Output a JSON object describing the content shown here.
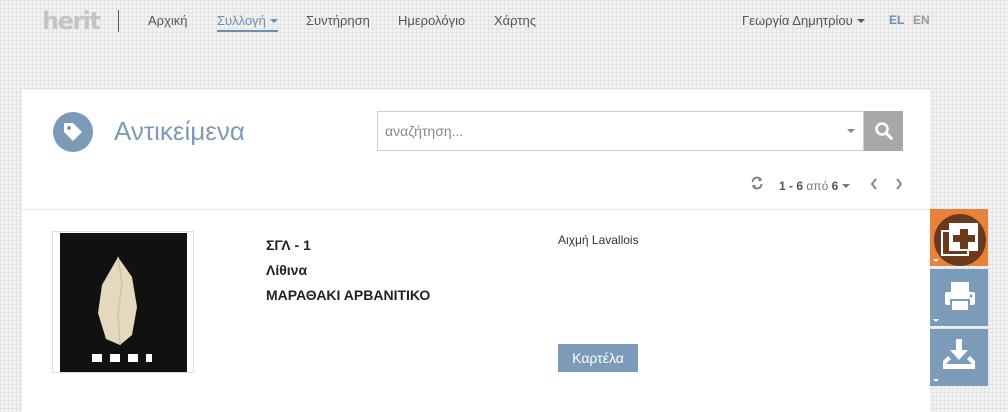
{
  "brand": {
    "logo_text": "herit"
  },
  "nav": {
    "items": [
      {
        "label": "Αρχική"
      },
      {
        "label": "Συλλογή"
      },
      {
        "label": "Συντήρηση"
      },
      {
        "label": "Ημερολόγιο"
      },
      {
        "label": "Χάρτης"
      }
    ],
    "active_item": "Συλλογή",
    "user": "Γεωργία Δημητρίου",
    "languages": [
      "EL",
      "EN"
    ],
    "active_language": "EL"
  },
  "page": {
    "title": "Αντικείμενα",
    "title_icon": "tag-icon"
  },
  "search": {
    "placeholder": "αναζήτηση...",
    "value": ""
  },
  "pagination": {
    "range": "1 - 6",
    "of_label": "από",
    "total": "6"
  },
  "record": {
    "code": "ΣΓΛ - 1",
    "material": "Λίθινα",
    "location": "ΜΑΡΑΘΑΚΙ ΑΡΒΑΝΙΤΙΚΟ",
    "description": "Αιχμή Lavallois",
    "card_button": "Καρτέλα"
  },
  "side_actions": [
    {
      "icon": "add-copy-icon",
      "color": "#e8813a"
    },
    {
      "icon": "print-icon",
      "color": "#7c9bb8"
    },
    {
      "icon": "download-icon",
      "color": "#7c9bb8"
    }
  ],
  "colors": {
    "accent": "#7c9bb8",
    "nav_active": "#6d8fae",
    "side_primary": "#e8813a"
  }
}
